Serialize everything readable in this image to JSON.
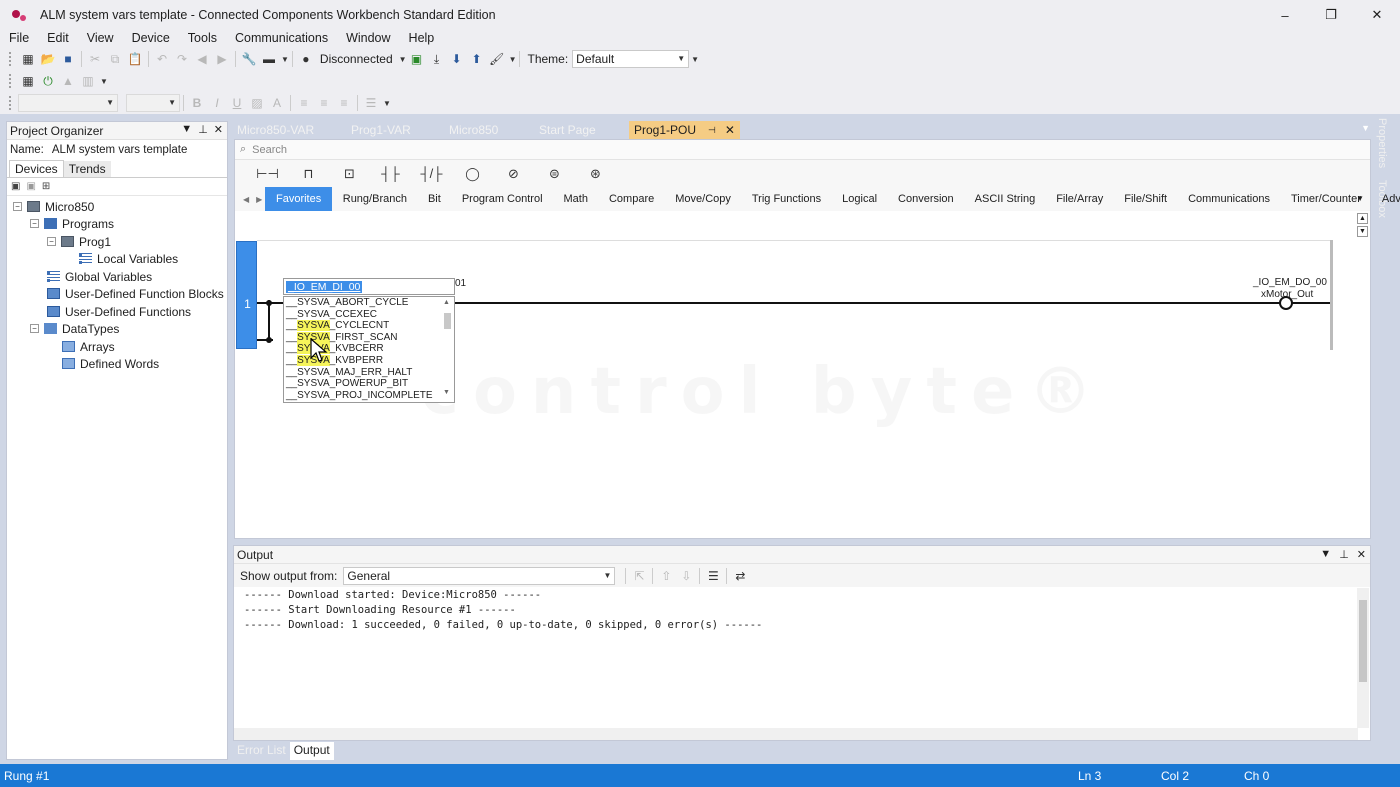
{
  "window": {
    "title": "ALM system vars template - Connected Components Workbench Standard Edition",
    "controls": [
      "–",
      "❐",
      "✕"
    ]
  },
  "menu": [
    "File",
    "Edit",
    "View",
    "Device",
    "Tools",
    "Communications",
    "Window",
    "Help"
  ],
  "toolbar": {
    "connection_status": "Disconnected",
    "theme_label": "Theme:",
    "theme_value": "Default"
  },
  "project_organizer": {
    "title": "Project Organizer",
    "name_label": "Name:",
    "name_value": "ALM system vars template",
    "tabs": [
      "Devices",
      "Trends"
    ],
    "tree": {
      "root": "Micro850",
      "programs": "Programs",
      "prog1": "Prog1",
      "local_vars": "Local Variables",
      "global_vars": "Global Variables",
      "udfb": "User-Defined Function Blocks",
      "udf": "User-Defined Functions",
      "datatypes": "DataTypes",
      "arrays": "Arrays",
      "defined_words": "Defined Words"
    }
  },
  "doc_tabs": [
    "Micro850-VAR",
    "Prog1-VAR",
    "Micro850",
    "Start Page",
    "Prog1-POU"
  ],
  "editor": {
    "search_placeholder": "Search",
    "categories": [
      "Favorites",
      "Rung/Branch",
      "Bit",
      "Program Control",
      "Math",
      "Compare",
      "Move/Copy",
      "Trig Functions",
      "Logical",
      "Conversion",
      "ASCII String",
      "File/Array",
      "File/Shift",
      "Communications",
      "Timer/Counter",
      "Advanced Mat"
    ],
    "rung_number": "1",
    "contact_label_tail": "01",
    "coil_variable": "_IO_EM_DO_00",
    "coil_alias": "xMotor_Out",
    "autocomplete": {
      "input_value": "_IO_EM_DI_00",
      "items": [
        "__SYSVA_ABORT_CYCLE",
        "__SYSVA_CCEXEC",
        "__SYSVA_CYCLECNT",
        "__SYSVA_FIRST_SCAN",
        "__SYSVA_KVBCERR",
        "__SYSVA_KVBPERR",
        "__SYSVA_MAJ_ERR_HALT",
        "__SYSVA_POWERUP_BIT",
        "__SYSVA_PROJ_INCOMPLETE"
      ]
    }
  },
  "right_tabs": [
    "Properties",
    "Toolbox"
  ],
  "output": {
    "title": "Output",
    "show_from_label": "Show output from:",
    "show_from_value": "General",
    "lines": [
      "------ Download started: Device:Micro850 ------",
      "------ Start Downloading Resource #1 ------",
      "------ Download: 1 succeeded, 0 failed, 0 up-to-date, 0 skipped, 0 error(s) ------"
    ]
  },
  "bottom_tabs": [
    "Error List",
    "Output"
  ],
  "status": {
    "left": "Rung #1",
    "ln": "Ln 3",
    "col": "Col 2",
    "ch": "Ch 0"
  }
}
